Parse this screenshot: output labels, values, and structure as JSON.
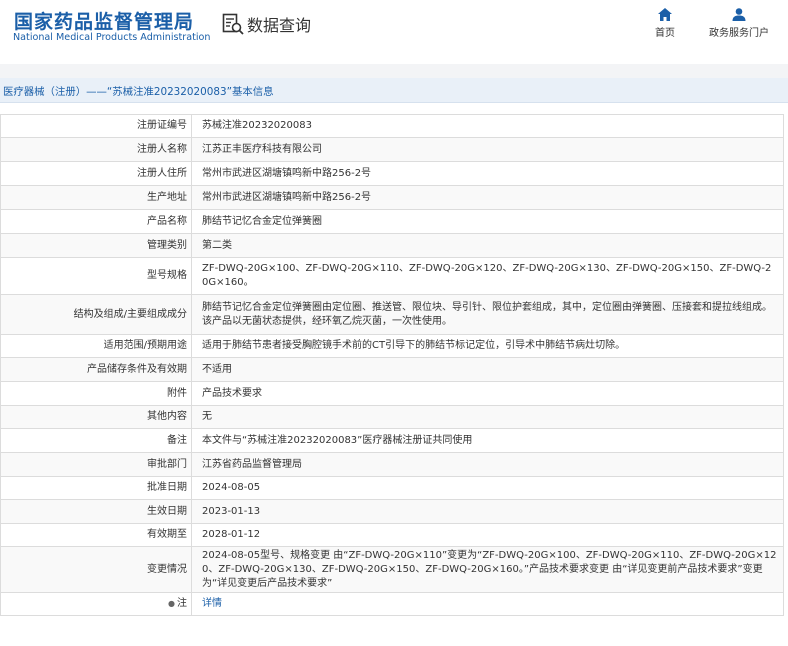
{
  "header": {
    "logo_cn": "国家药品监督管理局",
    "logo_en": "National Medical Products Administration",
    "query_label": "数据查询",
    "nav_home": "首页",
    "nav_service": "政务服务门户"
  },
  "title": "医疗器械（注册）——“苏械注准20232020083”基本信息",
  "rows": [
    {
      "label": "注册证编号",
      "value": "苏械注准20232020083"
    },
    {
      "label": "注册人名称",
      "value": "江苏正丰医疗科技有限公司"
    },
    {
      "label": "注册人住所",
      "value": "常州市武进区湖塘镇鸣新中路256-2号"
    },
    {
      "label": "生产地址",
      "value": "常州市武进区湖塘镇鸣新中路256-2号"
    },
    {
      "label": "产品名称",
      "value": "肺结节记忆合金定位弹簧圈"
    },
    {
      "label": "管理类别",
      "value": "第二类"
    },
    {
      "label": "型号规格",
      "value": "ZF-DWQ-20G×100、ZF-DWQ-20G×110、ZF-DWQ-20G×120、ZF-DWQ-20G×130、ZF-DWQ-20G×150、ZF-DWQ-20G×160。"
    },
    {
      "label": "结构及组成/主要组成成分",
      "value": "肺结节记忆合金定位弹簧圈由定位圈、推送管、限位块、导引针、限位护套组成，其中，定位圈由弹簧圈、压接套和提拉线组成。该产品以无菌状态提供，经环氧乙烷灭菌，一次性使用。"
    },
    {
      "label": "适用范围/预期用途",
      "value": "适用于肺结节患者接受胸腔镜手术前的CT引导下的肺结节标记定位，引导术中肺结节病灶切除。"
    },
    {
      "label": "产品储存条件及有效期",
      "value": "不适用"
    },
    {
      "label": "附件",
      "value": "产品技术要求"
    },
    {
      "label": "其他内容",
      "value": "无"
    },
    {
      "label": "备注",
      "value": "本文件与“苏械注准20232020083”医疗器械注册证共同使用"
    },
    {
      "label": "审批部门",
      "value": "江苏省药品监督管理局"
    },
    {
      "label": "批准日期",
      "value": "2024-08-05"
    },
    {
      "label": "生效日期",
      "value": "2023-01-13"
    },
    {
      "label": "有效期至",
      "value": "2028-01-12"
    },
    {
      "label": "变更情况",
      "value": "2024-08-05型号、规格变更 由“ZF-DWQ-20G×110”变更为“ZF-DWQ-20G×100、ZF-DWQ-20G×110、ZF-DWQ-20G×120、ZF-DWQ-20G×130、ZF-DWQ-20G×150、ZF-DWQ-20G×160。”产品技术要求变更 由“详见变更前产品技术要求”变更为“详见变更后产品技术要求”"
    },
    {
      "label": "注",
      "value": "详情"
    }
  ],
  "colors": {
    "brand_blue": "#1b5fa8",
    "title_bg": "#e9f0f8"
  }
}
